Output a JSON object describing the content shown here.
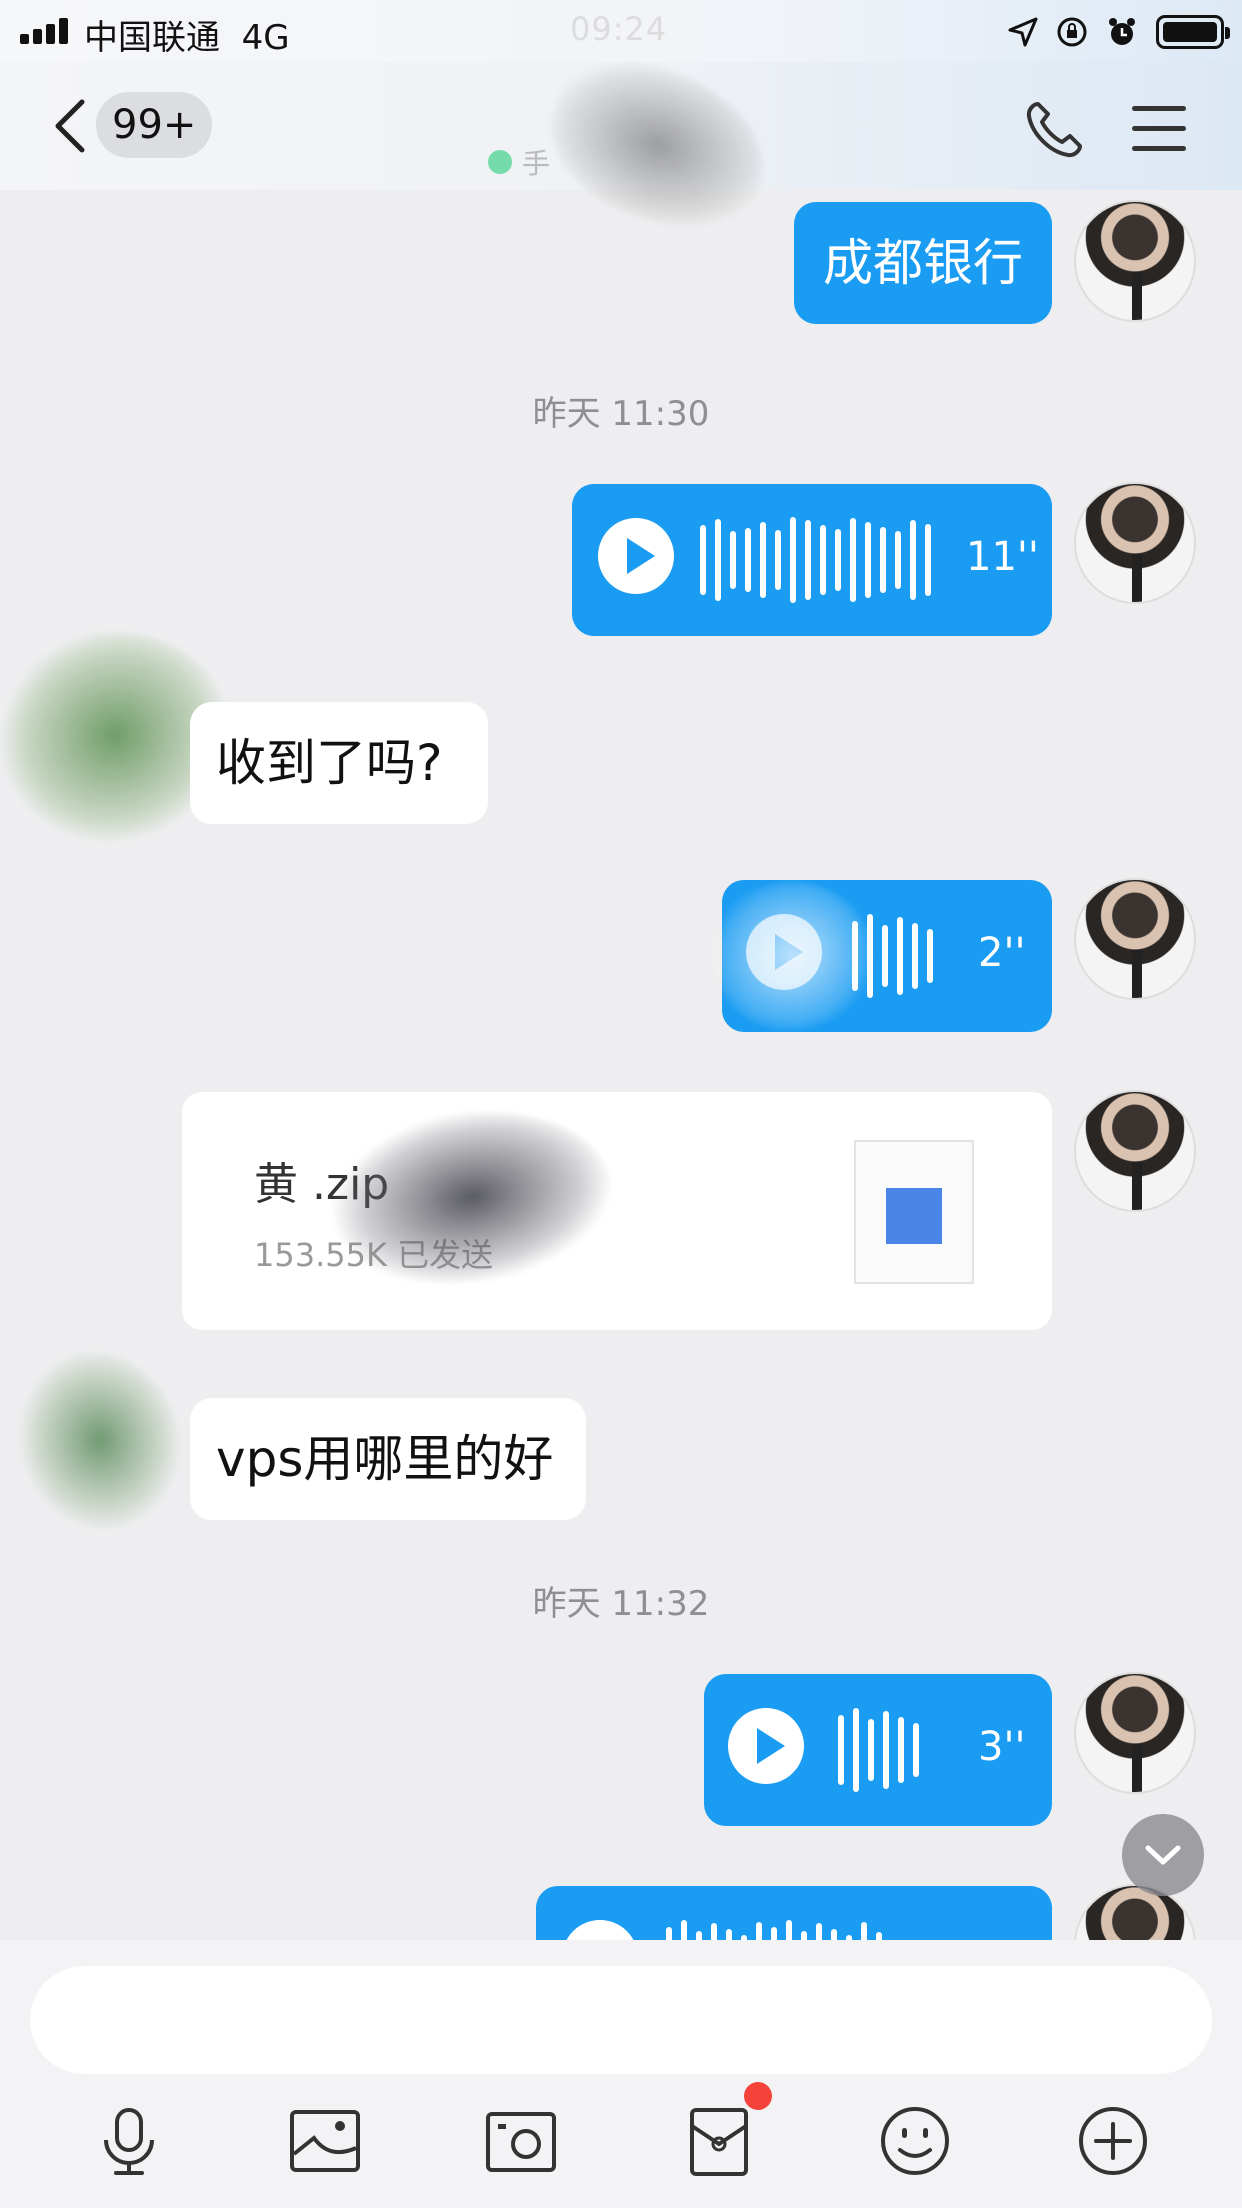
{
  "status_bar": {
    "carrier": "中国联通",
    "network": "4G",
    "time": "09:24"
  },
  "nav": {
    "unread_count": "99+",
    "contact_name": "",
    "online_status": "手"
  },
  "messages": {
    "out_text_1": "成都银行",
    "timestamp_1": "昨天 11:30",
    "voice_1_duration": "11''",
    "in_text_1": "收到了吗?",
    "voice_2_duration": "2''",
    "file_name": "黄 .zip",
    "file_meta": "153.55K 已发送",
    "in_text_2": "vps用哪里的好",
    "timestamp_2": "昨天 11:32",
    "voice_3_duration": "3''"
  },
  "input": {
    "placeholder": ""
  },
  "toolbar": {
    "items": [
      "microphone-icon",
      "image-icon",
      "camera-icon",
      "red-packet-icon",
      "emoji-icon",
      "plus-icon"
    ],
    "badge": true
  },
  "colors": {
    "accent": "#1a9cf2",
    "badge": "#f5433b",
    "background": "#eeeef0"
  }
}
